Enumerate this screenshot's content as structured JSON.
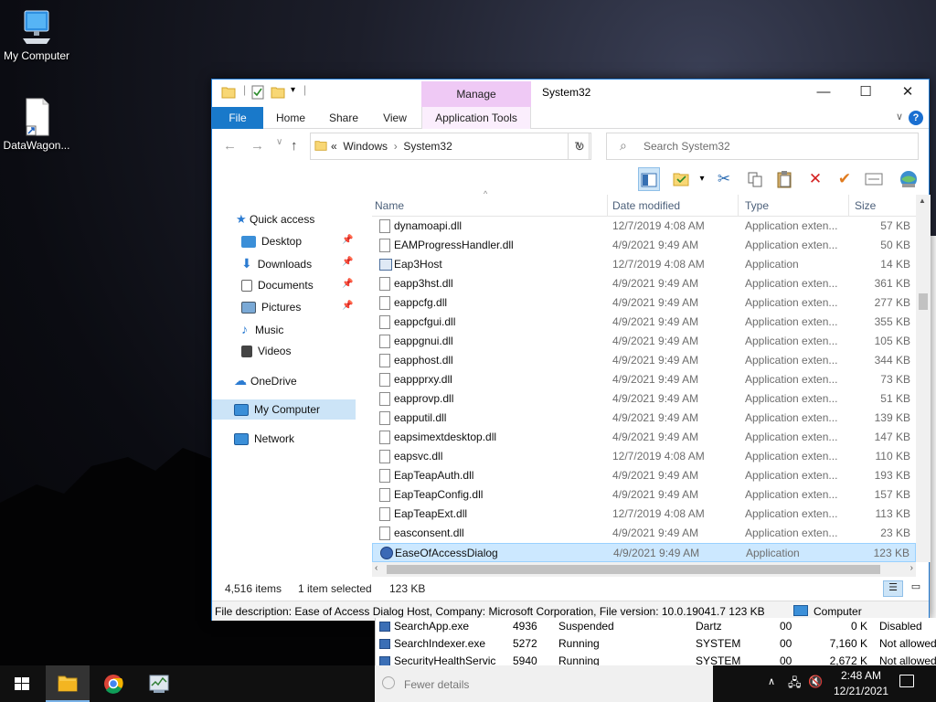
{
  "desktop": {
    "icons": [
      {
        "label": "My Computer",
        "icon": "monitor-icon"
      },
      {
        "label": "DataWagon...",
        "icon": "shortcut-file-icon"
      }
    ]
  },
  "explorer": {
    "title": "System32",
    "manage_tab": "Manage",
    "ribbon_tabs": {
      "file": "File",
      "home": "Home",
      "share": "Share",
      "view": "View",
      "app_tools": "Application Tools"
    },
    "help": "?",
    "address": {
      "crumb_prefix": "«",
      "crumbs": [
        "Windows",
        "System32"
      ]
    },
    "search_placeholder": "Search System32",
    "nav": {
      "quick_access": "Quick access",
      "desktop": "Desktop",
      "downloads": "Downloads",
      "documents": "Documents",
      "pictures": "Pictures",
      "music": "Music",
      "videos": "Videos",
      "onedrive": "OneDrive",
      "my_computer": "My Computer",
      "network": "Network"
    },
    "columns": {
      "name": "Name",
      "date": "Date modified",
      "type": "Type",
      "size": "Size"
    },
    "files": [
      {
        "name": "dynamoapi.dll",
        "date": "12/7/2019 4:08 AM",
        "type": "Application exten...",
        "size": "57 KB",
        "kind": "dll"
      },
      {
        "name": "EAMProgressHandler.dll",
        "date": "4/9/2021 9:49 AM",
        "type": "Application exten...",
        "size": "50 KB",
        "kind": "dll"
      },
      {
        "name": "Eap3Host",
        "date": "12/7/2019 4:08 AM",
        "type": "Application",
        "size": "14 KB",
        "kind": "app"
      },
      {
        "name": "eapp3hst.dll",
        "date": "4/9/2021 9:49 AM",
        "type": "Application exten...",
        "size": "361 KB",
        "kind": "dll"
      },
      {
        "name": "eappcfg.dll",
        "date": "4/9/2021 9:49 AM",
        "type": "Application exten...",
        "size": "277 KB",
        "kind": "dll"
      },
      {
        "name": "eappcfgui.dll",
        "date": "4/9/2021 9:49 AM",
        "type": "Application exten...",
        "size": "355 KB",
        "kind": "dll"
      },
      {
        "name": "eappgnui.dll",
        "date": "4/9/2021 9:49 AM",
        "type": "Application exten...",
        "size": "105 KB",
        "kind": "dll"
      },
      {
        "name": "eapphost.dll",
        "date": "4/9/2021 9:49 AM",
        "type": "Application exten...",
        "size": "344 KB",
        "kind": "dll"
      },
      {
        "name": "eappprxy.dll",
        "date": "4/9/2021 9:49 AM",
        "type": "Application exten...",
        "size": "73 KB",
        "kind": "dll"
      },
      {
        "name": "eapprovp.dll",
        "date": "4/9/2021 9:49 AM",
        "type": "Application exten...",
        "size": "51 KB",
        "kind": "dll"
      },
      {
        "name": "eapputil.dll",
        "date": "4/9/2021 9:49 AM",
        "type": "Application exten...",
        "size": "139 KB",
        "kind": "dll"
      },
      {
        "name": "eapsimextdesktop.dll",
        "date": "4/9/2021 9:49 AM",
        "type": "Application exten...",
        "size": "147 KB",
        "kind": "dll"
      },
      {
        "name": "eapsvc.dll",
        "date": "12/7/2019 4:08 AM",
        "type": "Application exten...",
        "size": "110 KB",
        "kind": "dll"
      },
      {
        "name": "EapTeapAuth.dll",
        "date": "4/9/2021 9:49 AM",
        "type": "Application exten...",
        "size": "193 KB",
        "kind": "dll"
      },
      {
        "name": "EapTeapConfig.dll",
        "date": "4/9/2021 9:49 AM",
        "type": "Application exten...",
        "size": "157 KB",
        "kind": "dll"
      },
      {
        "name": "EapTeapExt.dll",
        "date": "12/7/2019 4:08 AM",
        "type": "Application exten...",
        "size": "113 KB",
        "kind": "dll"
      },
      {
        "name": "easconsent.dll",
        "date": "4/9/2021 9:49 AM",
        "type": "Application exten...",
        "size": "23 KB",
        "kind": "dll"
      },
      {
        "name": "EaseOfAccessDialog",
        "date": "4/9/2021 9:49 AM",
        "type": "Application",
        "size": "123 KB",
        "kind": "ease",
        "selected": true
      }
    ],
    "status": {
      "items": "4,516 items",
      "selected": "1 item selected",
      "size": "123 KB"
    },
    "details": {
      "description": "File description: Ease of Access Dialog Host, Company: Microsoft Corporation, File version: 10.0.19041.7  123 KB",
      "location": "Computer"
    }
  },
  "taskmgr": {
    "rows": [
      {
        "name": "SearchApp.exe",
        "pid": "4936",
        "status": "Suspended",
        "user": "Dartz",
        "cpu": "00",
        "mem": "0 K",
        "uac": "Disabled"
      },
      {
        "name": "SearchIndexer.exe",
        "pid": "5272",
        "status": "Running",
        "user": "SYSTEM",
        "cpu": "00",
        "mem": "7,160 K",
        "uac": "Not allowed"
      },
      {
        "name": "SecurityHealthServic",
        "pid": "5940",
        "status": "Running",
        "user": "SYSTEM",
        "cpu": "00",
        "mem": "2,672 K",
        "uac": "Not allowed"
      }
    ],
    "fewer_details": "Fewer details"
  },
  "taskbar": {
    "time": "2:48 AM",
    "date": "12/21/2021"
  }
}
